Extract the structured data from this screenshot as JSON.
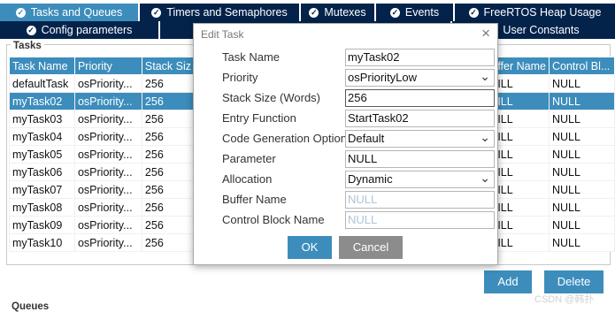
{
  "tabs_row1": [
    {
      "label": "Tasks and Queues",
      "active": true
    },
    {
      "label": "Timers and Semaphores",
      "active": false
    },
    {
      "label": "Mutexes",
      "active": false
    },
    {
      "label": "Events",
      "active": false
    },
    {
      "label": "FreeRTOS Heap Usage",
      "active": false
    }
  ],
  "tabs_row2": [
    {
      "label": "Config parameters"
    },
    {
      "label": "User Constants"
    }
  ],
  "tasks_section": {
    "legend": "Tasks",
    "columns": [
      "Task Name",
      "Priority",
      "Stack Siz",
      "ffer Name",
      "Control Bl..."
    ],
    "rows": [
      [
        "defaultTask",
        "osPriority...",
        "256",
        "ILL",
        "NULL"
      ],
      [
        "myTask02",
        "osPriority...",
        "256",
        "ILL",
        "NULL"
      ],
      [
        "myTask03",
        "osPriority...",
        "256",
        "ILL",
        "NULL"
      ],
      [
        "myTask04",
        "osPriority...",
        "256",
        "ILL",
        "NULL"
      ],
      [
        "myTask05",
        "osPriority...",
        "256",
        "ILL",
        "NULL"
      ],
      [
        "myTask06",
        "osPriority...",
        "256",
        "ILL",
        "NULL"
      ],
      [
        "myTask07",
        "osPriority...",
        "256",
        "ILL",
        "NULL"
      ],
      [
        "myTask08",
        "osPriority...",
        "256",
        "ILL",
        "NULL"
      ],
      [
        "myTask09",
        "osPriority...",
        "256",
        "ILL",
        "NULL"
      ],
      [
        "myTask10",
        "osPriority...",
        "256",
        "ILL",
        "NULL"
      ]
    ],
    "selected_row": 1,
    "add_label": "Add",
    "delete_label": "Delete"
  },
  "queues_label": "Queues",
  "watermark": "CSDN @韩扑",
  "dialog": {
    "title": "Edit Task",
    "fields": [
      {
        "label": "Task Name",
        "value": "myTask02",
        "kind": "text"
      },
      {
        "label": "Priority",
        "value": "osPriorityLow",
        "kind": "select"
      },
      {
        "label": "Stack Size (Words)",
        "value": "256",
        "kind": "text-focus"
      },
      {
        "label": "Entry Function",
        "value": "StartTask02",
        "kind": "text"
      },
      {
        "label": "Code Generation Option",
        "value": "Default",
        "kind": "select"
      },
      {
        "label": "Parameter",
        "value": "NULL",
        "kind": "text"
      },
      {
        "label": "Allocation",
        "value": "Dynamic",
        "kind": "select"
      },
      {
        "label": "Buffer Name",
        "value": "NULL",
        "kind": "placeholder"
      },
      {
        "label": "Control Block Name",
        "value": "NULL",
        "kind": "placeholder"
      }
    ],
    "ok_label": "OK",
    "cancel_label": "Cancel"
  },
  "colors": {
    "tab_bg": "#03234b",
    "accent": "#3c8dbc",
    "cancel_bg": "#8c8c8c"
  }
}
